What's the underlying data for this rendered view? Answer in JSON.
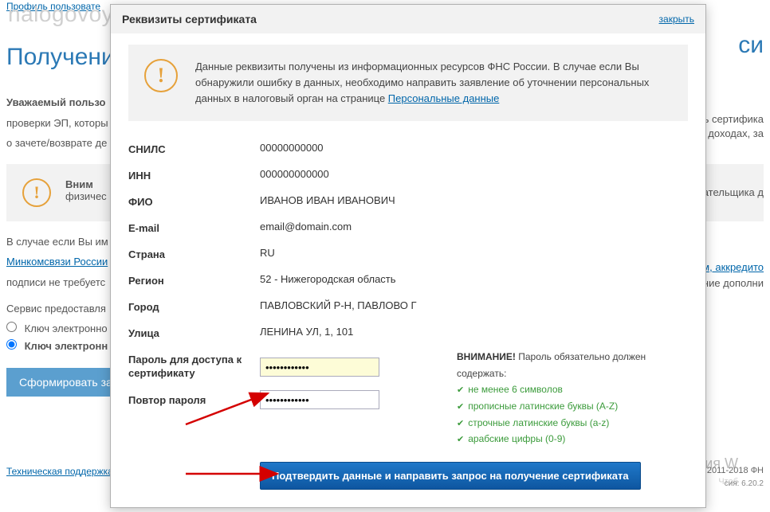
{
  "bg": {
    "profile_link": "Профиль пользовате",
    "watermark": "nalogovoy.net",
    "h1_left": "Получени",
    "h1_right": "си",
    "greeting": "Уважаемый пользо",
    "p1": "проверки ЭП, которы",
    "p2": "о зачете/возврате де",
    "p1_right": "ь сертифика",
    "p2_right": "доходах, за",
    "info_head": "Вним",
    "info_sub": "физичес",
    "info_right": "ательщика д",
    "p3": "В случае если Вы им",
    "p3_link": "м, аккредито",
    "p4_link": "Минкомсвязи России",
    "p4_right": "ние дополни",
    "p5": "подписи не требуетс",
    "p6": "Сервис предоставля",
    "radio1": "Ключ электронно",
    "radio2": "Ключ электронн",
    "btn": "Сформировать за",
    "footer_link": "Техническая поддержка",
    "activate": "Активация W",
    "activate_sub": "Чтоб",
    "copyright": "2011-2018 ФН",
    "ver": "сия: 6.20.2"
  },
  "modal": {
    "title": "Реквизиты сертификата",
    "close": "закрыть",
    "alert_text_1": "Данные реквизиты получены из информационных ресурсов ФНС России. В случае если Вы обнаружили ошибку в данных, необходимо направить заявление об уточнении персональных данных в налоговый орган на странице ",
    "alert_link": "Персональные данные",
    "fields": {
      "snils_label": "СНИЛС",
      "snils_value": "00000000000",
      "inn_label": "ИНН",
      "inn_value": "000000000000",
      "fio_label": "ФИО",
      "fio_value": "ИВАНОВ ИВАН ИВАНОВИЧ",
      "email_label": "E-mail",
      "email_value": "email@domain.com",
      "country_label": "Страна",
      "country_value": "RU",
      "region_label": "Регион",
      "region_value": "52 - Нижегородская область",
      "city_label": "Город",
      "city_value": "ПАВЛОВСКИЙ Р-Н, ПАВЛОВО Г",
      "street_label": "Улица",
      "street_value": "ЛЕНИНА УЛ, 1, 101"
    },
    "pwd": {
      "label1": "Пароль для доступа к сертификату",
      "label2": "Повтор пароля",
      "value1": "••••••••••••",
      "value2": "••••••••••••",
      "hint_header": "ВНИМАНИЕ!",
      "hint_header_rest": " Пароль обязательно должен содержать:",
      "h1": "не менее 6 символов",
      "h2": "прописные латинские буквы (A-Z)",
      "h3": "строчные латинские буквы (a-z)",
      "h4": "арабские цифры (0-9)"
    },
    "submit": "Подтвердить данные и направить запрос на получение сертификата"
  }
}
